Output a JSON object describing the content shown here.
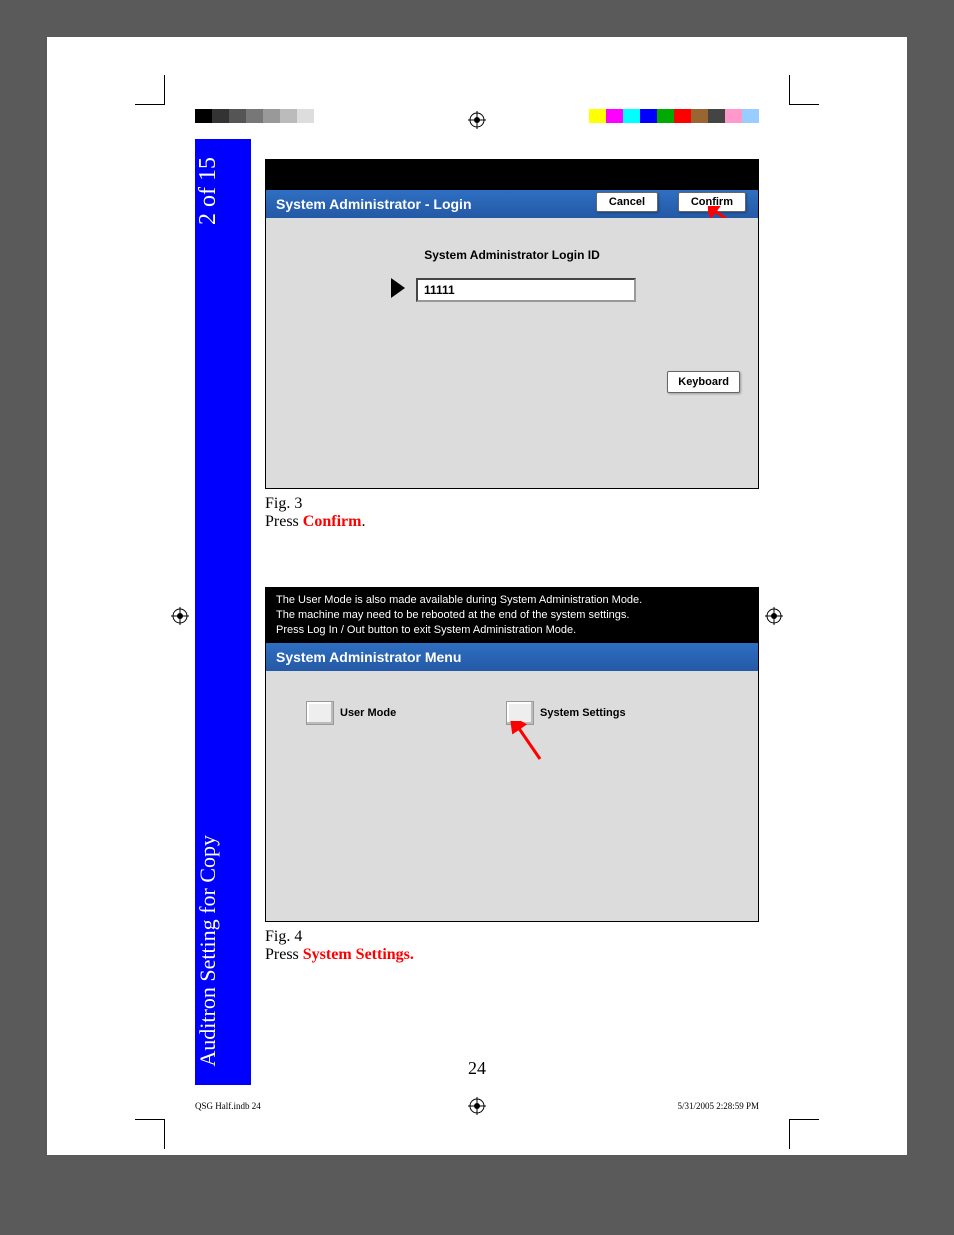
{
  "sidebar": {
    "page_indicator": "2 of 15",
    "section_title": "Auditron Setting for Copy"
  },
  "figure3": {
    "titlebar": "System Administrator - Login",
    "cancel": "Cancel",
    "confirm": "Confirm",
    "field_label": "System Administrator Login ID",
    "field_value": "11111",
    "keyboard": "Keyboard",
    "caption_label": "Fig. 3",
    "caption_prefix": "Press ",
    "caption_action": "Confirm",
    "caption_suffix": "."
  },
  "figure4": {
    "header_line1": "The User Mode is also made available during System Administration Mode.",
    "header_line2": "The machine may need to be rebooted at the end of the system settings.",
    "header_line3": "Press Log In / Out button to exit System Administration Mode.",
    "titlebar": "System Administrator Menu",
    "user_mode": "User Mode",
    "system_settings": "System Settings",
    "caption_label": "Fig. 4",
    "caption_prefix": "Press ",
    "caption_action": "System Settings.",
    "caption_suffix": ""
  },
  "page_number": "24",
  "footer": {
    "left": "QSG Half.indb   24",
    "right": "5/31/2005   2:28:59 PM"
  },
  "colors": {
    "gray_swatches": [
      "#000000",
      "#333333",
      "#555555",
      "#777777",
      "#999999",
      "#bbbbbb",
      "#dddddd",
      "#ffffff"
    ],
    "color_swatches": [
      "#ffff00",
      "#ff00ff",
      "#00ffff",
      "#0000ff",
      "#00aa00",
      "#ff0000",
      "#996633",
      "#444444",
      "#ff99cc",
      "#99ccff"
    ]
  }
}
